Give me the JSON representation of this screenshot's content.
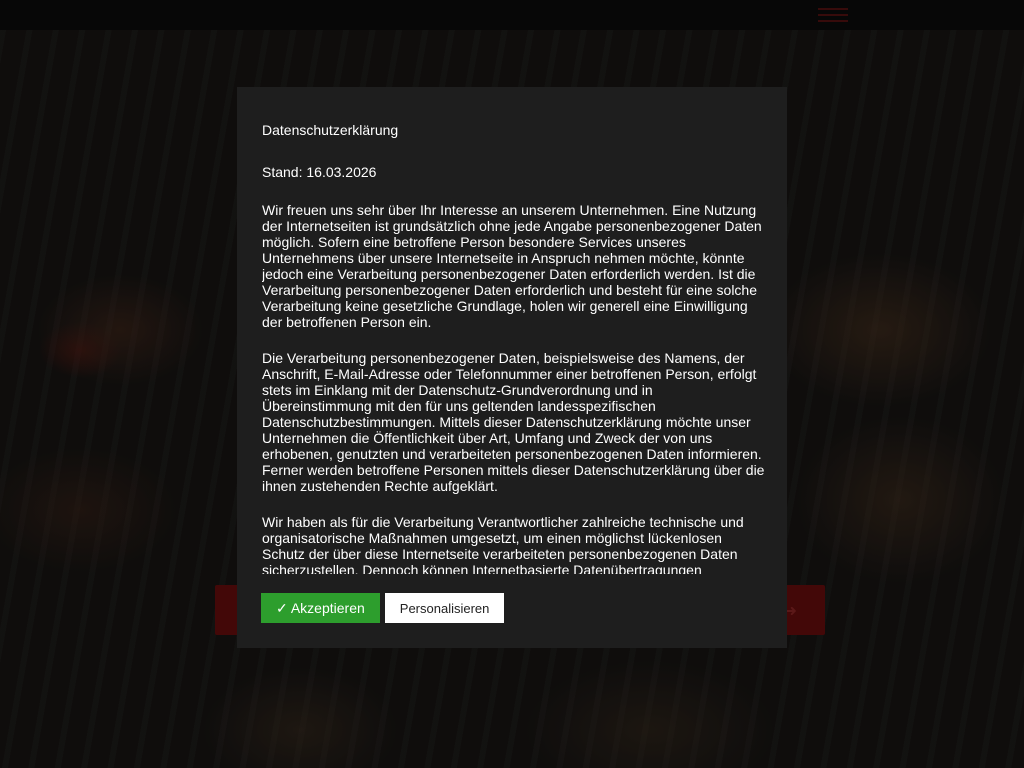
{
  "menu": {
    "icon": "hamburger-menu-icon"
  },
  "background_bar": {
    "icon": "arrow-icon"
  },
  "consent": {
    "title": "Datenschutzerklärung",
    "date": "Stand: 16.03.2026",
    "paragraphs": [
      "Wir freuen uns sehr über Ihr Interesse an unserem Unternehmen. Eine Nutzung der Internetseiten ist grundsätzlich ohne jede Angabe personenbezogener Daten möglich. Sofern eine betroffene Person besondere Services unseres Unternehmens über unsere Internetseite in Anspruch nehmen möchte, könnte jedoch eine Verarbeitung personenbezogener Daten erforderlich werden. Ist die Verarbeitung personenbezogener Daten erforderlich und besteht für eine solche Verarbeitung keine gesetzliche Grundlage, holen wir generell eine Einwilligung der betroffenen Person ein.",
      "Die Verarbeitung personenbezogener Daten, beispielsweise des Namens, der Anschrift, E-Mail-Adresse oder Telefonnummer einer betroffenen Person, erfolgt stets im Einklang mit der Datenschutz-Grundverordnung und in Übereinstimmung mit den für uns geltenden landesspezifischen Datenschutzbestimmungen. Mittels dieser Datenschutzerklärung möchte unser Unternehmen die Öffentlichkeit über Art, Umfang und Zweck der von uns erhobenen, genutzten und verarbeiteten personenbezogenen Daten informieren. Ferner werden betroffene Personen mittels dieser Datenschutzerklärung über die ihnen zustehenden Rechte aufgeklärt.",
      "Wir haben als für die Verarbeitung Verantwortlicher zahlreiche technische und organisatorische Maßnahmen umgesetzt, um einen möglichst lückenlosen Schutz der über diese Internetseite verarbeiteten personenbezogenen Daten sicherzustellen. Dennoch können Internetbasierte Datenübertragungen"
    ],
    "accept_label": "✓ Akzeptieren",
    "personalize_label": "Personalisieren"
  },
  "colors": {
    "modal_bg": "#1e1e1e",
    "accept_green": "#2d9e2d",
    "brand_red": "#5a0b0b"
  }
}
